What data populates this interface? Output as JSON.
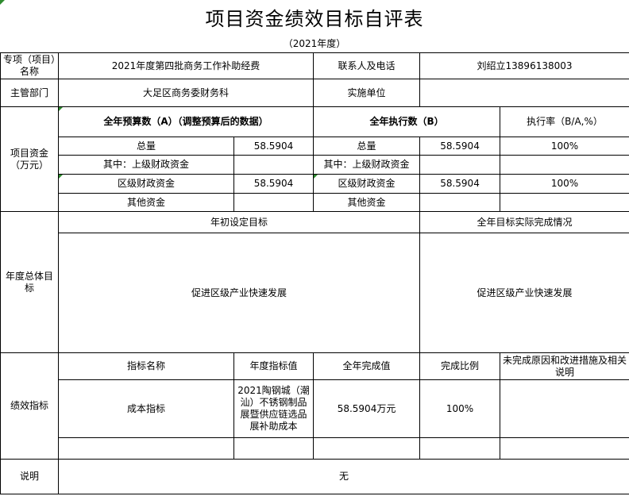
{
  "title": "项目资金绩效目标自评表",
  "year": "（2021年度）",
  "project": {
    "name_label": "专项（项目）名称",
    "name_value": "2021年度第四批商务工作补助经费",
    "contact_label": "联系人及电话",
    "contact_value": "刘绍立13896138003",
    "dept_label": "主管部门",
    "dept_value": "大足区商务委财务科",
    "impl_label": "实施单位",
    "impl_value": ""
  },
  "funds": {
    "section_label": "项目资金（万元）",
    "budget_header": "全年预算数（A）（调整预算后的数据）",
    "exec_header": "全年执行数（B）",
    "rate_header": "执行率（B/A,%）",
    "rows": [
      {
        "b_label": "总量",
        "b_value": "58.5904",
        "e_label": "总量",
        "e_value": "58.5904",
        "rate": "100%"
      },
      {
        "b_label": "其中：上级财政资金",
        "b_value": "",
        "e_label": "其中：上级财政资金",
        "e_value": "",
        "rate": ""
      },
      {
        "b_label": "区级财政资金",
        "b_value": "58.5904",
        "e_label": "区级财政资金",
        "e_value": "58.5904",
        "rate": "100%"
      },
      {
        "b_label": "其他资金",
        "b_value": "",
        "e_label": "其他资金",
        "e_value": "",
        "rate": ""
      }
    ]
  },
  "goals": {
    "section_label": "年度总体目标",
    "initial_header": "年初设定目标",
    "actual_header": "全年目标实际完成情况",
    "initial_text": "促进区级产业快速发展",
    "actual_text": "促进区级产业快速发展"
  },
  "kpi": {
    "section_label": "绩效指标",
    "headers": [
      "指标名称",
      "年度指标值",
      "全年完成值",
      "完成比例",
      "未完成原因和改进措施及相关说明"
    ],
    "rows": [
      {
        "name": "成本指标",
        "target": "2021陶钢城（潮汕）不锈钢制品展暨供应链选品展补助成本",
        "actual": "58.5904万元",
        "ratio": "100%",
        "note": ""
      }
    ]
  },
  "remark": {
    "label": "说明",
    "value": "无"
  }
}
